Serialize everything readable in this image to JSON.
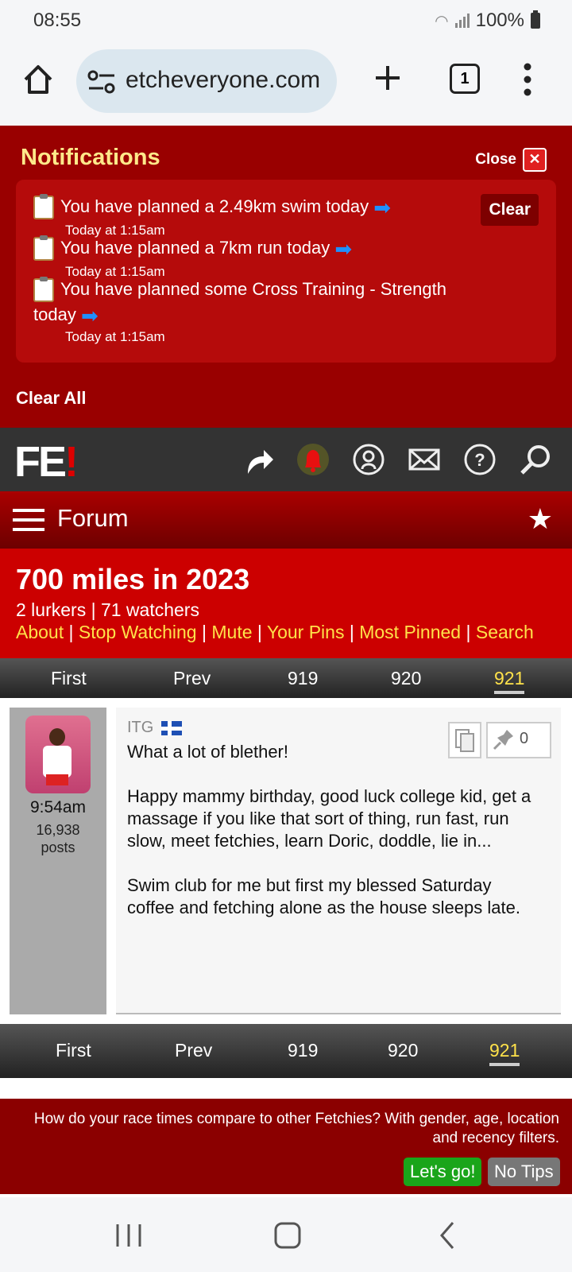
{
  "status": {
    "time": "08:55",
    "battery": "100%"
  },
  "browser": {
    "url": "etcheveryone.com",
    "tab_count": "1"
  },
  "notifications": {
    "title": "Notifications",
    "close_label": "Close",
    "clear_label": "Clear",
    "clear_all_label": "Clear All",
    "items": [
      {
        "text": "You have planned a 2.49km swim today",
        "time": "Today at 1:15am"
      },
      {
        "text": "You have planned a 7km run today",
        "time": "Today at 1:15am"
      },
      {
        "text": "You have planned some Cross Training - Strength today",
        "time": "Today at 1:15am"
      }
    ]
  },
  "site": {
    "logo": "FE",
    "logo_bang": "!"
  },
  "forumbar": {
    "label": "Forum"
  },
  "thread": {
    "title": "700 miles in 2023",
    "meta": "2 lurkers | 71 watchers",
    "links": [
      "About",
      "Stop Watching",
      "Mute",
      "Your Pins",
      "Most Pinned",
      "Search"
    ]
  },
  "pager": {
    "first": "First",
    "prev": "Prev",
    "pages": [
      "919",
      "920",
      "921"
    ],
    "current": "921"
  },
  "post": {
    "author": "ITG",
    "time": "9:54am",
    "count": "16,938",
    "count_label": "posts",
    "pin_count": "0",
    "body": "What a lot of blether!\n\nHappy mammy birthday, good luck college kid, get a massage if you like that sort of thing, run fast, run slow, meet fetchies, learn Doric, doddle, lie in...\n\nSwim club for me but first my blessed Saturday coffee and fetching alone as the house sleeps late."
  },
  "tip": {
    "message": "How do your race times compare to other Fetchies? With gender, age, location and recency filters.",
    "go_label": "Let's go!",
    "no_label": "No Tips"
  }
}
